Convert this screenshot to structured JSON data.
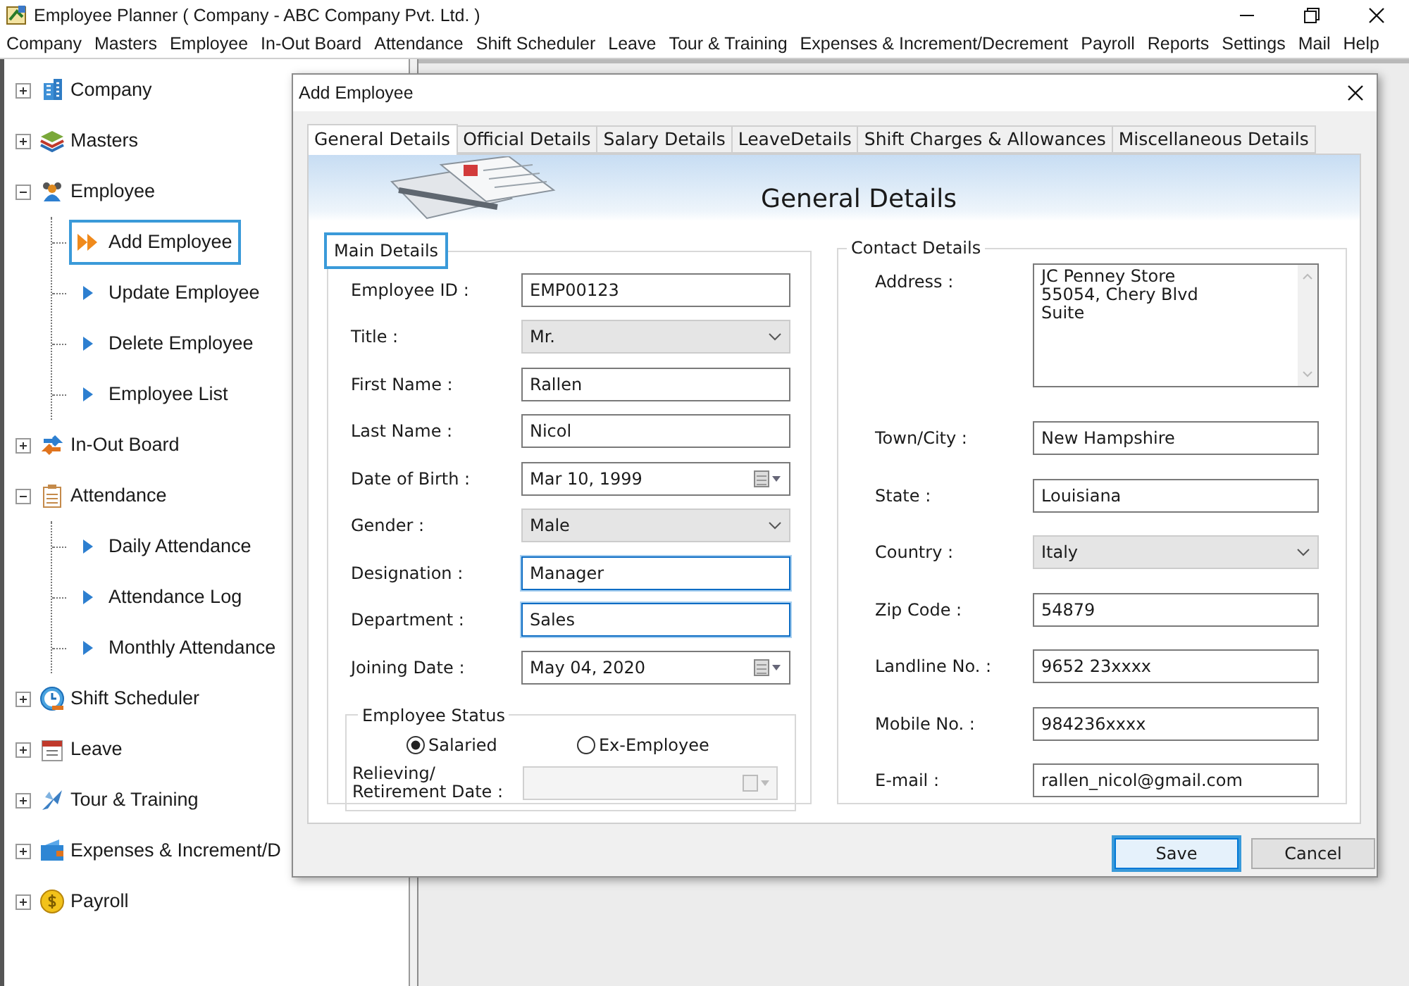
{
  "window": {
    "title": "Employee Planner ( Company - ABC Company Pvt. Ltd. )"
  },
  "menu": [
    "Company",
    "Masters",
    "Employee",
    "In-Out Board",
    "Attendance",
    "Shift Scheduler",
    "Leave",
    "Tour & Training",
    "Expenses & Increment/Decrement",
    "Payroll",
    "Reports",
    "Settings",
    "Mail",
    "Help"
  ],
  "sidebar": {
    "items": [
      {
        "label": "Company",
        "expanded": false
      },
      {
        "label": "Masters",
        "expanded": false
      },
      {
        "label": "Employee",
        "expanded": true,
        "children": [
          {
            "label": "Add Employee",
            "selected": true
          },
          {
            "label": "Update Employee",
            "selected": false
          },
          {
            "label": "Delete Employee",
            "selected": false
          },
          {
            "label": "Employee List",
            "selected": false
          }
        ]
      },
      {
        "label": "In-Out Board",
        "expanded": false
      },
      {
        "label": "Attendance",
        "expanded": true,
        "children": [
          {
            "label": "Daily Attendance",
            "selected": false
          },
          {
            "label": "Attendance Log",
            "selected": false
          },
          {
            "label": "Monthly Attendance",
            "selected": false
          }
        ]
      },
      {
        "label": "Shift Scheduler",
        "expanded": false
      },
      {
        "label": "Leave",
        "expanded": false
      },
      {
        "label": "Tour & Training",
        "expanded": false
      },
      {
        "label": "Expenses & Increment/D",
        "expanded": false
      },
      {
        "label": "Payroll",
        "expanded": false
      }
    ]
  },
  "dialog": {
    "title": "Add Employee",
    "tabs": [
      {
        "label": "General Details",
        "selected": true
      },
      {
        "label": "Official Details",
        "selected": false
      },
      {
        "label": "Salary Details",
        "selected": false
      },
      {
        "label": "LeaveDetails",
        "selected": false
      },
      {
        "label": "Shift Charges & Allowances",
        "selected": false
      },
      {
        "label": "Miscellaneous Details",
        "selected": false
      }
    ],
    "heading": "General Details",
    "main_details": {
      "title": "Main Details",
      "highlighted": true,
      "fields": [
        {
          "label": "Employee ID :",
          "kind": "text",
          "value": "EMP00123",
          "focused": false
        },
        {
          "label": "Title :",
          "kind": "select",
          "value": "Mr."
        },
        {
          "label": "First Name :",
          "kind": "text",
          "value": "Rallen",
          "focused": false
        },
        {
          "label": "Last Name :",
          "kind": "text",
          "value": "Nicol",
          "focused": false
        },
        {
          "label": "Date of Birth :",
          "kind": "date",
          "value": "Mar 10, 1999"
        },
        {
          "label": "Gender :",
          "kind": "select",
          "value": "Male"
        },
        {
          "label": "Designation :",
          "kind": "text",
          "value": "Manager",
          "focused": true
        },
        {
          "label": "Department :",
          "kind": "text",
          "value": "Sales",
          "focused": true
        },
        {
          "label": "Joining Date :",
          "kind": "date",
          "value": "May 04, 2020"
        }
      ]
    },
    "employee_status": {
      "title": "Employee Status",
      "options": [
        {
          "label": "Salaried",
          "selected": true
        },
        {
          "label": "Ex-Employee",
          "selected": false
        }
      ],
      "relieving_date": {
        "label": "Relieving/\nRetirement Date :",
        "disabled": true
      }
    },
    "contact_details": {
      "title": "Contact Details",
      "fields": [
        {
          "label": "Address :",
          "kind": "textarea",
          "value": "JC Penney Store\n55054, Chery Blvd\nSuite"
        },
        {
          "label": "Town/City :",
          "kind": "text",
          "value": "New Hampshire"
        },
        {
          "label": "State :",
          "kind": "text",
          "value": "Louisiana"
        },
        {
          "label": "Country :",
          "kind": "select",
          "value": "Italy"
        },
        {
          "label": "Zip Code :",
          "kind": "text",
          "value": "54879"
        },
        {
          "label": "Landline No. :",
          "kind": "text",
          "value": "9652 23xxxx"
        },
        {
          "label": "Mobile No. :",
          "kind": "text",
          "value": "984236xxxx"
        },
        {
          "label": "E-mail :",
          "kind": "text",
          "value": "rallen_nicol@gmail.com"
        }
      ]
    },
    "buttons": [
      {
        "label": "Save",
        "highlighted": true
      },
      {
        "label": "Cancel",
        "highlighted": false
      }
    ]
  }
}
